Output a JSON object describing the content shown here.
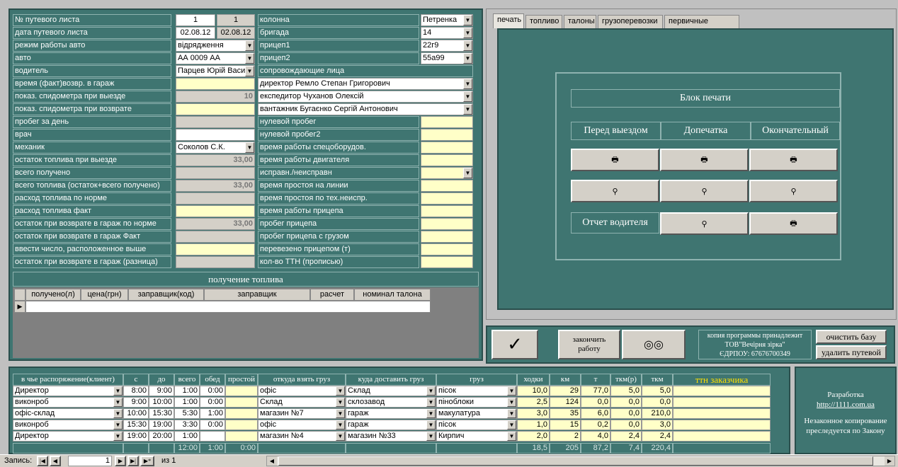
{
  "left": {
    "labels": [
      "№ путевого листа",
      "дата путевого листа",
      "режим работы авто",
      "авто",
      "водитель",
      "время (факт)возвр. в гараж",
      "показ. спидометра при выезде",
      "показ. спидометра при возврате",
      "пробег за день",
      "врач",
      "механик",
      "остаток топлива при выезде",
      "всего получено",
      "всего топлива (остаток+всего получено)",
      "расход топлива по норме",
      "расход топлива факт",
      "остаток при возврате в гараж по норме",
      "остаток при возврате в гараж  Факт",
      "ввести число, расположенное выше",
      "остаток при возврате в гараж (разница)"
    ],
    "number": "1",
    "number2": "1",
    "date": "02.08.12",
    "date2": "02.08.12",
    "mode": "відрядження",
    "auto": "АА 0009 АА",
    "driver": "Парцев Юрій Васи",
    "speedo_out": "10",
    "mechanic": "Соколов С.К.",
    "fuel_out": "33,00",
    "fuel_total": "33,00",
    "fuel_norm_rest": "33,00"
  },
  "mid": {
    "labels": [
      "колонна",
      "бригада",
      "прицеп1",
      "прицеп2",
      "сопровождающие лица"
    ],
    "column": "Петренка",
    "brigade": "14",
    "trailer1": "22г9",
    "trailer2": "55а99",
    "escorts": [
      "директор Ремло Степан Григорович",
      "експедитор Чуханов Олексій",
      "вантажник Бугаєнко Сергій Антонович"
    ],
    "labels2": [
      "нулевой пробег",
      "нулевой пробег2",
      "время работы спецоборудов.",
      "время работы двигателя",
      "исправн./неисправн",
      "время простоя на линии",
      "время простоя по тех.неиспр.",
      "время работы прицепа",
      "пробег прицепа",
      "пробег прицепа с грузом",
      "перевезено прицепом (т)",
      "кол-во ТТН (прописью)"
    ]
  },
  "fuel": {
    "title": "получение топлива",
    "cols": [
      "получено(л)",
      "цена(грн)",
      "заправщик(код)",
      "заправщик",
      "расчет",
      "номинал талона"
    ]
  },
  "tabs": [
    "печать",
    "топливо",
    "талоны",
    "грузоперевозки",
    "первичные данные"
  ],
  "print": {
    "title": "Блок печати",
    "cols": [
      "Перед выездом",
      "Допечатка",
      "Окончательный"
    ],
    "driver_report": "Отчет водителя"
  },
  "actions": {
    "finish": "закончить работу",
    "copy_line1": "копия программы принадлежит",
    "copy_line2": "ТОВ\"Вечірня зірка\"",
    "copy_line3": "ЄДРПОУ: 67676700349",
    "clear": "очистить базу",
    "delete": "удалить путевой"
  },
  "trips": {
    "cols": [
      "в чье распоряжение(клиент)",
      "с",
      "до",
      "всего",
      "обед",
      "простой",
      "откуда взять груз",
      "куда доставить груз",
      "груз",
      "ходки",
      "км",
      "т",
      "ткм(р)",
      "ткм",
      "ттн заказчика"
    ],
    "rows": [
      [
        "Директор",
        "8:00",
        "9:00",
        "1:00",
        "0:00",
        "",
        "офіс",
        "Склад",
        "пісок",
        "10,0",
        "29",
        "77,0",
        "5,0",
        "5,0"
      ],
      [
        "виконроб",
        "9:00",
        "10:00",
        "1:00",
        "0:00",
        "",
        "Склад",
        "склозавод",
        "піноблоки",
        "2,5",
        "124",
        "0,0",
        "0,0",
        "0,0"
      ],
      [
        "офіс-склад",
        "10:00",
        "15:30",
        "5:30",
        "1:00",
        "",
        "магазин №7",
        "гараж",
        "макулатура",
        "3,0",
        "35",
        "6,0",
        "0,0",
        "210,0"
      ],
      [
        "виконроб",
        "15:30",
        "19:00",
        "3:30",
        "0:00",
        "",
        "офіс",
        "гараж",
        "пісок",
        "1,0",
        "15",
        "0,2",
        "0,0",
        "3,0"
      ],
      [
        "Директор",
        "19:00",
        "20:00",
        "1:00",
        "",
        "",
        "магазин №4",
        "магазин №33",
        "Кирпич",
        "2,0",
        "2",
        "4,0",
        "2,4",
        "2,4"
      ]
    ],
    "totals": {
      "total": "12:00",
      "lunch": "1:00",
      "idle": "0:00",
      "trips": "18,5",
      "km": "205",
      "t": "87,2",
      "tkmr": "7,4",
      "tkm": "220,4"
    }
  },
  "dev": {
    "line1": "Разработка",
    "link": "http://1111.com.ua",
    "line2": "Незаконное копирование преследуется по Закону"
  },
  "nav": {
    "label": "Запись:",
    "current": "1",
    "of": "из  1"
  }
}
